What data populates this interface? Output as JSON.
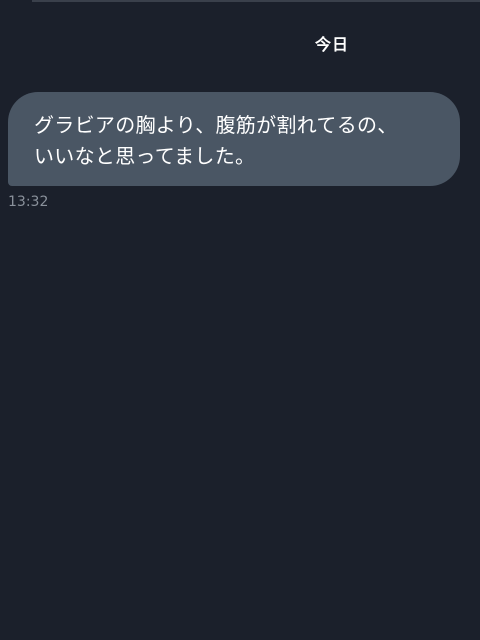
{
  "header": {
    "date_separator": "今日"
  },
  "messages": [
    {
      "text": "グラビアの胸より、腹筋が割れてるの、\nいいなと思ってました。",
      "time": "13:32"
    }
  ],
  "colors": {
    "background": "#1b202b",
    "bubble": "#4a5664",
    "text": "#ffffff",
    "timestamp": "#8a919b"
  }
}
